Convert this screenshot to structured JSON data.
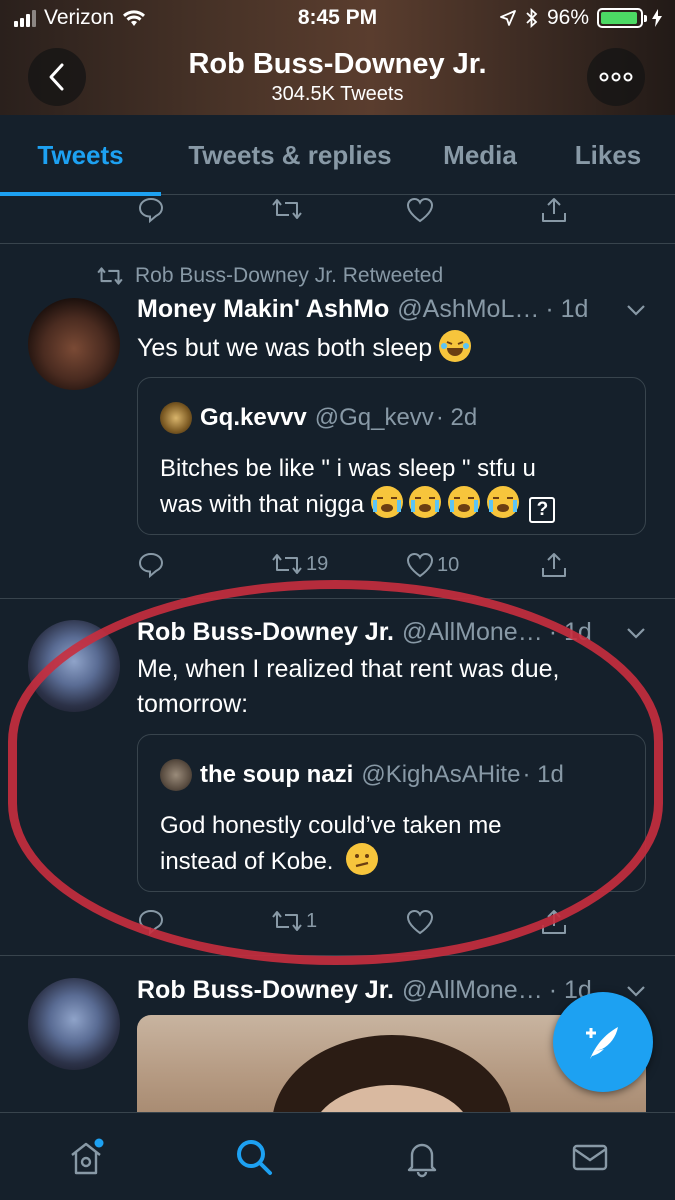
{
  "status_bar": {
    "carrier": "Verizon",
    "time": "8:45 PM",
    "battery": "96%",
    "battery_level": 0.96
  },
  "header": {
    "title": "Rob Buss-Downey Jr.",
    "subtitle": "304.5K Tweets"
  },
  "tabs": [
    {
      "label": "Tweets",
      "active": true
    },
    {
      "label": "Tweets & replies",
      "active": false
    },
    {
      "label": "Media",
      "active": false
    },
    {
      "label": "Likes",
      "active": false
    }
  ],
  "tweets": [
    {
      "retweet_label": "Rob Buss-Downey Jr. Retweeted",
      "name": "Money Makin' AshMo",
      "handle": "@AshMoL…",
      "time": "· 1d",
      "text": "Yes but we was both sleep",
      "quote": {
        "name": "Gq.kevvv",
        "handle": "@Gq_kevv",
        "time": "· 2d",
        "text_line1": "Bitches be like \" i was sleep \" stfu u",
        "text_line2": "was with that nigga",
        "unknown_glyph": "?"
      },
      "retweets": "19",
      "likes": "10"
    },
    {
      "name": "Rob Buss-Downey Jr.",
      "handle": "@AllMone…",
      "time": "· 1d",
      "text_line1": "Me, when I realized that rent was due,",
      "text_line2": "tomorrow:",
      "quote": {
        "name": "the soup nazi",
        "handle": "@KighAsAHite",
        "time": "· 1d",
        "text_line1": "God honestly could’ve taken me",
        "text_line2": "instead of Kobe."
      },
      "retweets": "1",
      "likes": ""
    },
    {
      "name": "Rob Buss-Downey Jr.",
      "handle": "@AllMone…",
      "time": "· 1d"
    }
  ],
  "colors": {
    "accent": "#1da1f2",
    "background": "#15202b",
    "muted": "#8899a6",
    "highlight": "#c82d3e"
  }
}
